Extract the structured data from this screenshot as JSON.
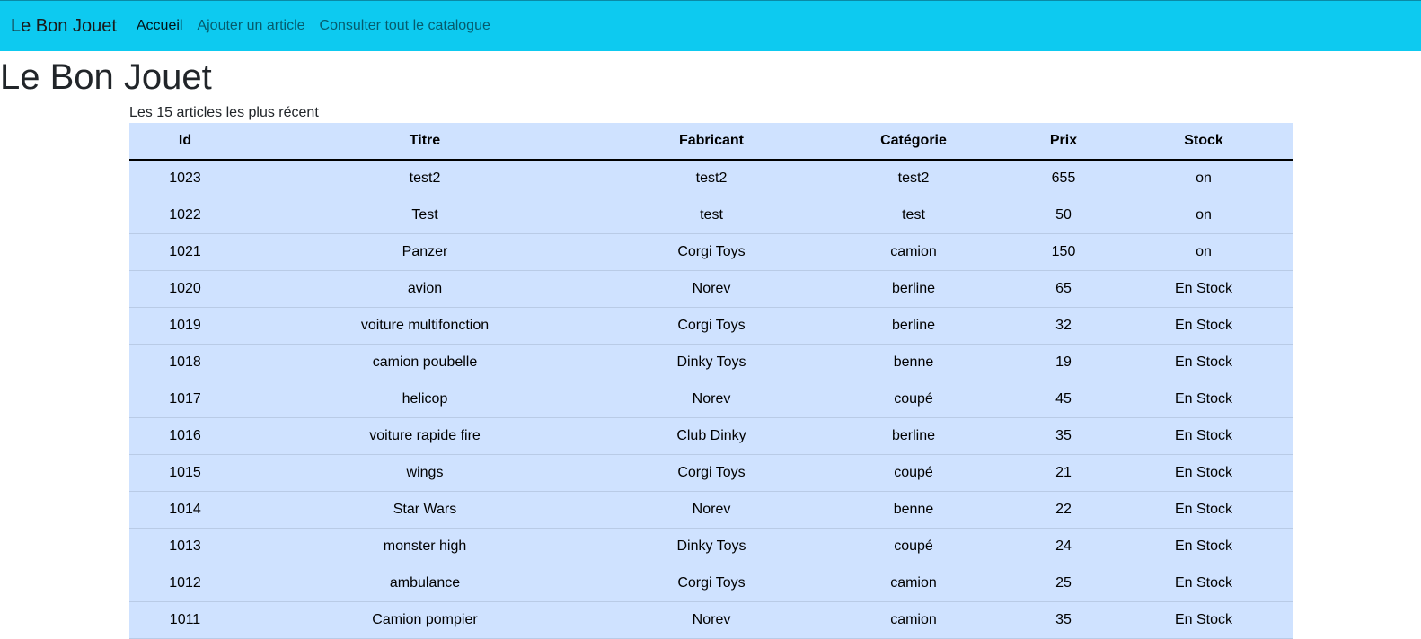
{
  "navbar": {
    "brand": "Le Bon Jouet",
    "links": [
      "Accueil",
      "Ajouter un article",
      "Consulter tout le catalogue"
    ]
  },
  "page": {
    "title": "Le Bon Jouet",
    "subtitle": "Les 15 articles les plus récent"
  },
  "table": {
    "headers": [
      "Id",
      "Titre",
      "Fabricant",
      "Catégorie",
      "Prix",
      "Stock"
    ],
    "rows": [
      [
        "1023",
        "test2",
        "test2",
        "test2",
        "655",
        "on"
      ],
      [
        "1022",
        "Test",
        "test",
        "test",
        "50",
        "on"
      ],
      [
        "1021",
        "Panzer",
        "Corgi Toys",
        "camion",
        "150",
        "on"
      ],
      [
        "1020",
        "avion",
        "Norev",
        "berline",
        "65",
        "En Stock"
      ],
      [
        "1019",
        "voiture multifonction",
        "Corgi Toys",
        "berline",
        "32",
        "En Stock"
      ],
      [
        "1018",
        "camion poubelle",
        "Dinky Toys",
        "benne",
        "19",
        "En Stock"
      ],
      [
        "1017",
        "helicop",
        "Norev",
        "coupé",
        "45",
        "En Stock"
      ],
      [
        "1016",
        "voiture rapide fire",
        "Club Dinky",
        "berline",
        "35",
        "En Stock"
      ],
      [
        "1015",
        "wings",
        "Corgi Toys",
        "coupé",
        "21",
        "En Stock"
      ],
      [
        "1014",
        "Star Wars",
        "Norev",
        "benne",
        "22",
        "En Stock"
      ],
      [
        "1013",
        "monster high",
        "Dinky Toys",
        "coupé",
        "24",
        "En Stock"
      ],
      [
        "1012",
        "ambulance",
        "Corgi Toys",
        "camion",
        "25",
        "En Stock"
      ],
      [
        "1011",
        "Camion pompier",
        "Norev",
        "camion",
        "35",
        "En Stock"
      ]
    ]
  },
  "colors": {
    "navbar_bg": "#0dcaf0",
    "table_bg": "#cfe2ff"
  }
}
